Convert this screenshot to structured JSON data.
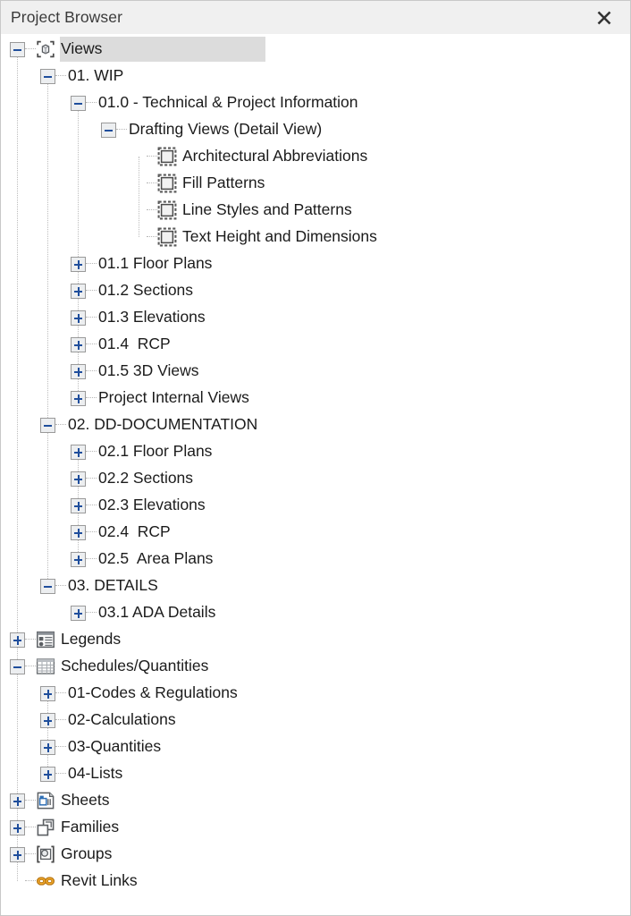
{
  "window": {
    "title": "Project Browser",
    "close_label": "✕",
    "close_icon": "close-icon"
  },
  "colors": {
    "titlebar_bg": "#f0f0f0",
    "panel_bg": "#ffffff",
    "selection_bg": "#dcdcdc",
    "expander_glyph": "#1f4e9c",
    "text": "#1b1b1b",
    "guide_line": "#bdbdbd",
    "revit_links_icon": "#e8a317"
  },
  "tree": {
    "nodes": [
      {
        "id": "views",
        "label": "Views",
        "depth": 0,
        "state": "expanded",
        "icon": "views-icon",
        "selected": true
      },
      {
        "id": "wip",
        "label": "01. WIP",
        "depth": 1,
        "state": "expanded",
        "icon": "none",
        "selected": false
      },
      {
        "id": "tech-project-info",
        "label": "01.0 - Technical & Project Information",
        "depth": 2,
        "state": "expanded",
        "icon": "none",
        "selected": false
      },
      {
        "id": "drafting-views",
        "label": "Drafting Views (Detail View)",
        "depth": 3,
        "state": "expanded",
        "icon": "none",
        "selected": false
      },
      {
        "id": "arch-abbreviations",
        "label": "Architectural Abbreviations",
        "depth": 4,
        "state": "leaf",
        "icon": "detail-view-icon",
        "selected": false
      },
      {
        "id": "fill-patterns",
        "label": "Fill Patterns",
        "depth": 4,
        "state": "leaf",
        "icon": "detail-view-icon",
        "selected": false
      },
      {
        "id": "line-styles-patterns",
        "label": "Line Styles and Patterns",
        "depth": 4,
        "state": "leaf",
        "icon": "detail-view-icon",
        "selected": false
      },
      {
        "id": "text-height-dimensions",
        "label": "Text Height and Dimensions",
        "depth": 4,
        "state": "leaf",
        "icon": "detail-view-icon",
        "selected": false
      },
      {
        "id": "wip-floor-plans",
        "label": "01.1 Floor Plans",
        "depth": 2,
        "state": "collapsed",
        "icon": "none",
        "selected": false
      },
      {
        "id": "wip-sections",
        "label": "01.2 Sections",
        "depth": 2,
        "state": "collapsed",
        "icon": "none",
        "selected": false
      },
      {
        "id": "wip-elevations",
        "label": "01.3 Elevations",
        "depth": 2,
        "state": "collapsed",
        "icon": "none",
        "selected": false
      },
      {
        "id": "wip-rcp",
        "label": "01.4  RCP",
        "depth": 2,
        "state": "collapsed",
        "icon": "none",
        "selected": false
      },
      {
        "id": "wip-3d-views",
        "label": "01.5 3D Views",
        "depth": 2,
        "state": "collapsed",
        "icon": "none",
        "selected": false
      },
      {
        "id": "project-internal-views",
        "label": "Project Internal Views",
        "depth": 2,
        "state": "collapsed",
        "icon": "none",
        "selected": false
      },
      {
        "id": "dd-documentation",
        "label": "02. DD-DOCUMENTATION",
        "depth": 1,
        "state": "expanded",
        "icon": "none",
        "selected": false
      },
      {
        "id": "dd-floor-plans",
        "label": "02.1 Floor Plans",
        "depth": 2,
        "state": "collapsed",
        "icon": "none",
        "selected": false
      },
      {
        "id": "dd-sections",
        "label": "02.2 Sections",
        "depth": 2,
        "state": "collapsed",
        "icon": "none",
        "selected": false
      },
      {
        "id": "dd-elevations",
        "label": "02.3 Elevations",
        "depth": 2,
        "state": "collapsed",
        "icon": "none",
        "selected": false
      },
      {
        "id": "dd-rcp",
        "label": "02.4  RCP",
        "depth": 2,
        "state": "collapsed",
        "icon": "none",
        "selected": false
      },
      {
        "id": "dd-area-plans",
        "label": "02.5  Area Plans",
        "depth": 2,
        "state": "collapsed",
        "icon": "none",
        "selected": false
      },
      {
        "id": "details",
        "label": "03. DETAILS",
        "depth": 1,
        "state": "expanded",
        "icon": "none",
        "selected": false
      },
      {
        "id": "ada-details",
        "label": "03.1 ADA Details",
        "depth": 2,
        "state": "collapsed",
        "icon": "none",
        "selected": false
      },
      {
        "id": "legends",
        "label": "Legends",
        "depth": 0,
        "state": "collapsed",
        "icon": "legend-icon",
        "selected": false
      },
      {
        "id": "schedules-quantities",
        "label": "Schedules/Quantities",
        "depth": 0,
        "state": "expanded",
        "icon": "schedule-icon",
        "selected": false
      },
      {
        "id": "codes-regulations",
        "label": "01-Codes & Regulations",
        "depth": 1,
        "state": "collapsed",
        "icon": "none",
        "selected": false
      },
      {
        "id": "calculations",
        "label": "02-Calculations",
        "depth": 1,
        "state": "collapsed",
        "icon": "none",
        "selected": false
      },
      {
        "id": "quantities",
        "label": "03-Quantities",
        "depth": 1,
        "state": "collapsed",
        "icon": "none",
        "selected": false
      },
      {
        "id": "lists",
        "label": "04-Lists",
        "depth": 1,
        "state": "collapsed",
        "icon": "none",
        "selected": false
      },
      {
        "id": "sheets",
        "label": "Sheets",
        "depth": 0,
        "state": "collapsed",
        "icon": "sheets-icon",
        "selected": false
      },
      {
        "id": "families",
        "label": "Families",
        "depth": 0,
        "state": "collapsed",
        "icon": "families-icon",
        "selected": false
      },
      {
        "id": "groups",
        "label": "Groups",
        "depth": 0,
        "state": "collapsed",
        "icon": "groups-icon",
        "selected": false
      },
      {
        "id": "revit-links",
        "label": "Revit Links",
        "depth": 0,
        "state": "leaf",
        "icon": "revit-links-icon",
        "selected": false
      }
    ]
  }
}
